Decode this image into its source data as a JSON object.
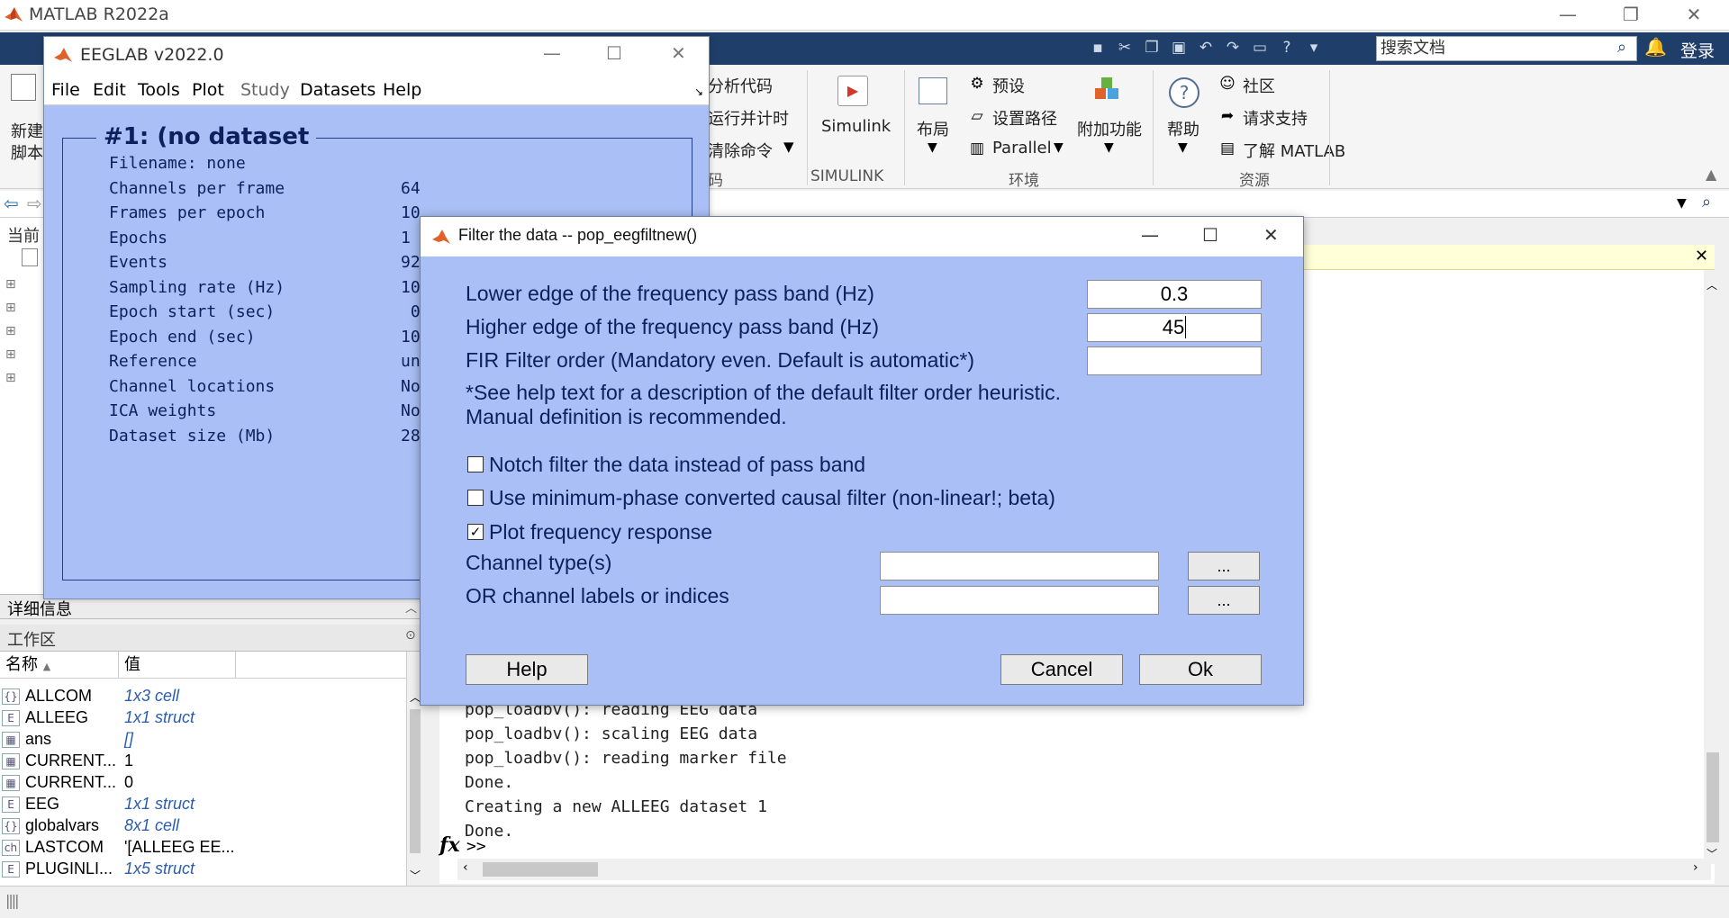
{
  "matlab": {
    "title": "MATLAB R2022a",
    "search_placeholder": "搜索文档",
    "login_label": "登录",
    "ribbon": {
      "new_script": [
        "新建",
        "脚本"
      ],
      "code_items": [
        "分析代码",
        "运行并计时",
        "清除命令"
      ],
      "code_group": "码",
      "simulink_label": "Simulink",
      "simulink_group": "SIMULINK",
      "layout_label": "布局",
      "prefs_label": "预设",
      "setpath_label": "设置路径",
      "parallel_label": "Parallel",
      "addons_label": "附加功能",
      "env_group": "环境",
      "help_label": "帮助",
      "community_label": "社区",
      "support_label": "请求支持",
      "learn_label": "了解 MATLAB",
      "resources_group": "资源"
    },
    "current_folder_label": "当前",
    "details_label": "详细信息",
    "workspace": {
      "title": "工作区",
      "col_name": "名称",
      "col_value": "值",
      "rows": [
        {
          "name": "ALLCOM",
          "value": "1x3 cell",
          "icon": "{}",
          "italic": true
        },
        {
          "name": "ALLEEG",
          "value": "1x1 struct",
          "icon": "E",
          "italic": true
        },
        {
          "name": "ans",
          "value": "[]",
          "icon": "▦",
          "italic": true
        },
        {
          "name": "CURRENT...",
          "value": "1",
          "icon": "▦",
          "italic": false
        },
        {
          "name": "CURRENT...",
          "value": "0",
          "icon": "▦",
          "italic": false
        },
        {
          "name": "EEG",
          "value": "1x1 struct",
          "icon": "E",
          "italic": true
        },
        {
          "name": "globalvars",
          "value": "8x1 cell",
          "icon": "{}",
          "italic": true
        },
        {
          "name": "LASTCOM",
          "value": "'[ALLEEG EE...",
          "icon": "ch",
          "italic": false
        },
        {
          "name": "PLUGINLI...",
          "value": "1x5 struct",
          "icon": "E",
          "italic": true
        }
      ]
    },
    "command_window": {
      "lines": [
        "pop_loadbv(): reading EEG data",
        "pop_loadbv(): scaling EEG data",
        "pop_loadbv(): reading marker file",
        "Done.",
        "Creating a new ALLEEG dataset 1",
        "Done."
      ],
      "fx": "fx",
      "prompt": ">>"
    }
  },
  "eeglab": {
    "title": "EEGLAB v2022.0",
    "menus": [
      "File",
      "Edit",
      "Tools",
      "Plot",
      "Study",
      "Datasets",
      "Help"
    ],
    "dataset_title": "#1: (no dataset",
    "fields": [
      {
        "label": "Filename: none",
        "value": ""
      },
      {
        "label": "Channels per frame",
        "value": "64"
      },
      {
        "label": "Frames per epoch",
        "value": "10"
      },
      {
        "label": "Epochs",
        "value": "1"
      },
      {
        "label": "Events",
        "value": "92"
      },
      {
        "label": "Sampling rate (Hz)",
        "value": "10"
      },
      {
        "label": "Epoch start (sec)",
        "value": " 0"
      },
      {
        "label": "Epoch end (sec)",
        "value": "10"
      },
      {
        "label": "Reference",
        "value": "un"
      },
      {
        "label": "Channel locations",
        "value": "No"
      },
      {
        "label": "ICA weights",
        "value": "No"
      },
      {
        "label": "Dataset size (Mb)",
        "value": "28"
      }
    ]
  },
  "filter_dialog": {
    "title": "Filter the data -- pop_eegfiltnew()",
    "lower_edge_label": "Lower edge of the frequency pass band (Hz)",
    "lower_edge_value": "0.3",
    "higher_edge_label": "Higher edge of the frequency pass band (Hz)",
    "higher_edge_value": "45",
    "fir_order_label": "FIR Filter order (Mandatory even. Default is automatic*)",
    "fir_order_value": "",
    "note_line1": "*See help text for a description of the default filter order heuristic.",
    "note_line2": "Manual definition is recommended.",
    "notch_label": "Notch filter the data instead of pass band",
    "notch_checked": false,
    "minphase_label": "Use minimum-phase converted causal filter (non-linear!; beta)",
    "minphase_checked": false,
    "plotfreq_label": "Plot frequency response",
    "plotfreq_checked": true,
    "chantype_label": "Channel type(s)",
    "chanlabels_label": "OR channel labels or indices",
    "browse_label": "...",
    "help_button": "Help",
    "cancel_button": "Cancel",
    "ok_button": "Ok"
  }
}
